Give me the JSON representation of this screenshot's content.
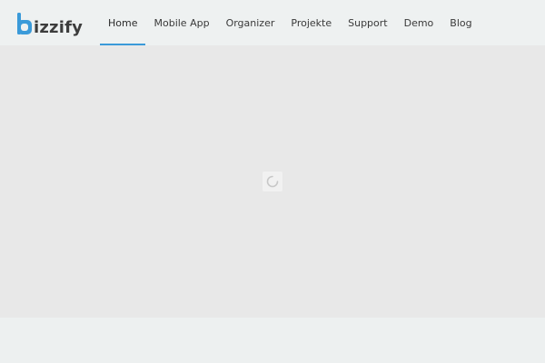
{
  "brand": {
    "logo_letter": "b",
    "logo_text": "izzify",
    "accent_color": "#3a9ad9"
  },
  "nav": {
    "items": [
      {
        "label": "Home",
        "active": true
      },
      {
        "label": "Mobile App",
        "active": false
      },
      {
        "label": "Organizer",
        "active": false
      },
      {
        "label": "Projekte",
        "active": false
      },
      {
        "label": "Support",
        "active": false
      },
      {
        "label": "Demo",
        "active": false
      },
      {
        "label": "Blog",
        "active": false
      }
    ]
  },
  "hero": {
    "loader_icon": "spinner-icon"
  }
}
